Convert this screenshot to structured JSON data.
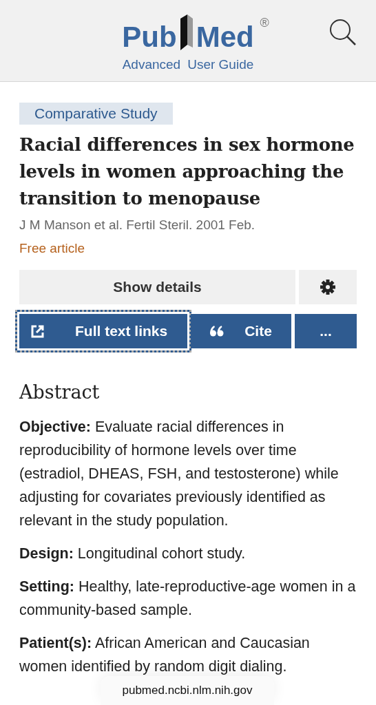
{
  "header": {
    "logo": {
      "left": "Pub",
      "right": "Med",
      "mark": "®"
    },
    "links": [
      "Advanced",
      "User Guide"
    ]
  },
  "article": {
    "type": "Comparative Study",
    "title": "Racial differences in sex hormone levels in women approaching the transition to menopause",
    "citation": "J M Manson et al. Fertil Steril. 2001 Feb.",
    "free": "Free article"
  },
  "actions": [
    {
      "kind": "details",
      "label": "Show details",
      "focused": false
    },
    {
      "kind": "settings",
      "focused": false
    },
    {
      "kind": "fulltext",
      "label": "Full text links",
      "focused": true
    },
    {
      "kind": "cite",
      "label": "Cite",
      "focused": false
    },
    {
      "kind": "more",
      "label": "...",
      "focused": false
    }
  ],
  "abstract": {
    "heading": "Abstract",
    "paragraphs": [
      "**Objective:** Evaluate racial differences in reproducibility of hormone levels over time (estradiol, DHEAS, FSH, and testosterone) while adjusting for covariates previously identified as relevant in the study population.",
      "**Design:** Longitudinal cohort study.",
      "**Setting:** Healthy, late-reproductive-age women in a community-based sample.",
      "**Patient(s):** African American and Caucasian women identified by random digit dialing."
    ]
  },
  "url_bar": "pubmed.ncbi.nlm.nih.gov"
}
